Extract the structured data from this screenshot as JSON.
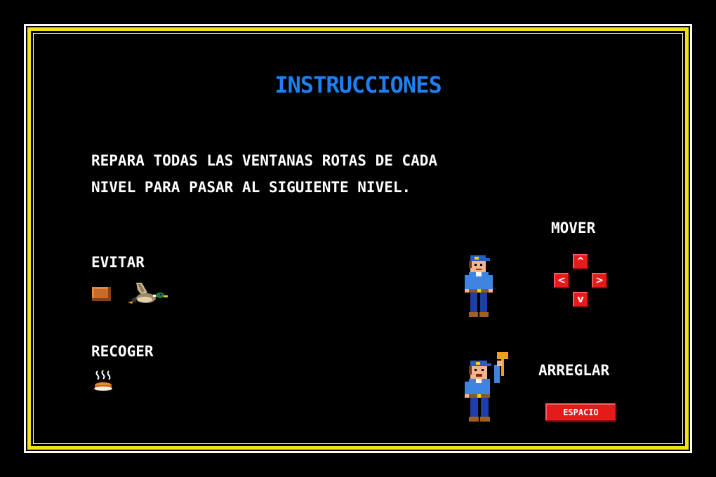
{
  "screen": {
    "title": "INSTRUCCIONES",
    "description_line1": "REPARA TODAS LAS VENTANAS ROTAS DE CADA",
    "description_line2": "NIVEL PARA PASAR AL SIGUIENTE NIVEL."
  },
  "avoid": {
    "label": "EVITAR",
    "icons": [
      "brick-icon",
      "duck-icon"
    ]
  },
  "collect": {
    "label": "RECOGER",
    "icons": [
      "pie-icon"
    ]
  },
  "controls": {
    "move_label": "MOVER",
    "fix_label": "ARREGLAR",
    "space_key_label": "ESPACIO",
    "up_glyph": "^",
    "left_glyph": "<",
    "right_glyph": ">",
    "down_glyph": "v"
  },
  "colors": {
    "title": "#1e80f2",
    "frame_yellow": "#f5df1d",
    "key_red": "#e51b1b",
    "text": "#ffffff",
    "background": "#000000"
  }
}
